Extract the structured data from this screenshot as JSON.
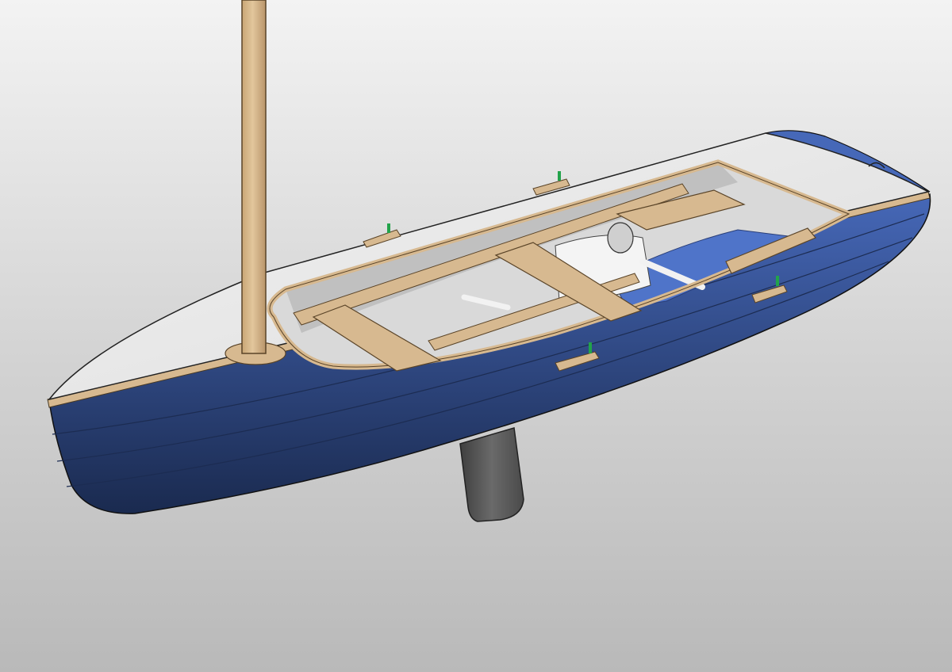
{
  "render": {
    "hull_color": "#4668b8",
    "hull_shadow": "#1a2a4f",
    "deck_color": "#e6e6e6",
    "interior_color": "#d9d9d9",
    "wood_color": "#d7b990",
    "wood_edge": "#6f5633",
    "floor_color": "#4f74c9",
    "fin_color": "#5a5a5a",
    "fitting_color": "#22a34a"
  }
}
